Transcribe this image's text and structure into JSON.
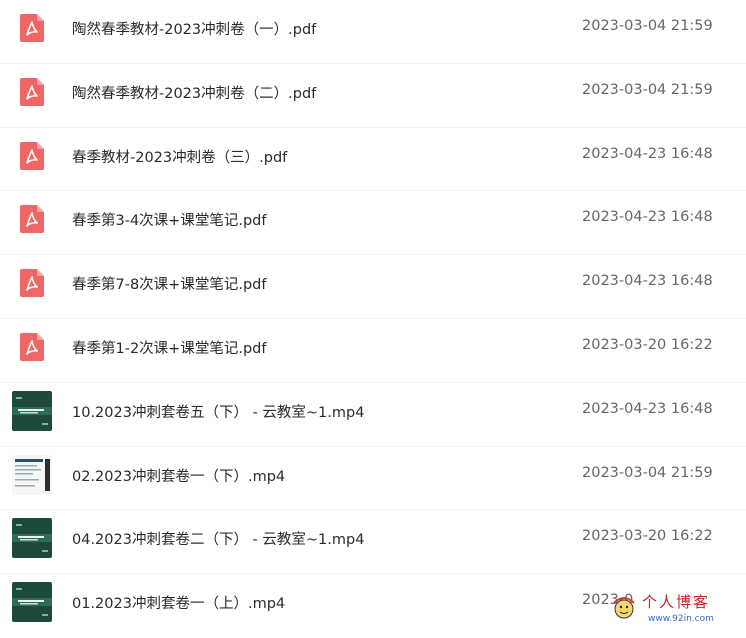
{
  "files": [
    {
      "name": "陶然春季教材-2023冲刺卷（一）.pdf",
      "date": "2023-03-04 21:59",
      "type": "pdf",
      "icon": "pdf-file-icon"
    },
    {
      "name": "陶然春季教材-2023冲刺卷（二）.pdf",
      "date": "2023-03-04 21:59",
      "type": "pdf",
      "icon": "pdf-file-icon"
    },
    {
      "name": "春季教材-2023冲刺卷（三）.pdf",
      "date": "2023-04-23 16:48",
      "type": "pdf",
      "icon": "pdf-file-icon"
    },
    {
      "name": "春季第3-4次课+课堂笔记.pdf",
      "date": "2023-04-23 16:48",
      "type": "pdf",
      "icon": "pdf-file-icon"
    },
    {
      "name": "春季第7-8次课+课堂笔记.pdf",
      "date": "2023-04-23 16:48",
      "type": "pdf",
      "icon": "pdf-file-icon"
    },
    {
      "name": "春季第1-2次课+课堂笔记.pdf",
      "date": "2023-03-20 16:22",
      "type": "pdf",
      "icon": "pdf-file-icon"
    },
    {
      "name": "10.2023冲刺套卷五（下） - 云教室~1.mp4",
      "date": "2023-04-23 16:48",
      "type": "video",
      "thumb": "dark",
      "icon": "video-thumbnail"
    },
    {
      "name": "02.2023冲刺套卷一（下）.mp4",
      "date": "2023-03-04 21:59",
      "type": "video",
      "thumb": "light",
      "icon": "video-thumbnail"
    },
    {
      "name": "04.2023冲刺套卷二（下） - 云教室~1.mp4",
      "date": "2023-03-20 16:22",
      "type": "video",
      "thumb": "dark",
      "icon": "video-thumbnail"
    },
    {
      "name": "01.2023冲刺套卷一（上）.mp4",
      "date": "2023-0",
      "type": "video",
      "thumb": "dark",
      "icon": "video-thumbnail"
    }
  ],
  "watermark": {
    "text": "个人博客",
    "url": "www.92in.com",
    "color": "#cc2222"
  },
  "colors": {
    "pdf_icon": "#f06565",
    "video_dark": "#1e4a3e"
  }
}
